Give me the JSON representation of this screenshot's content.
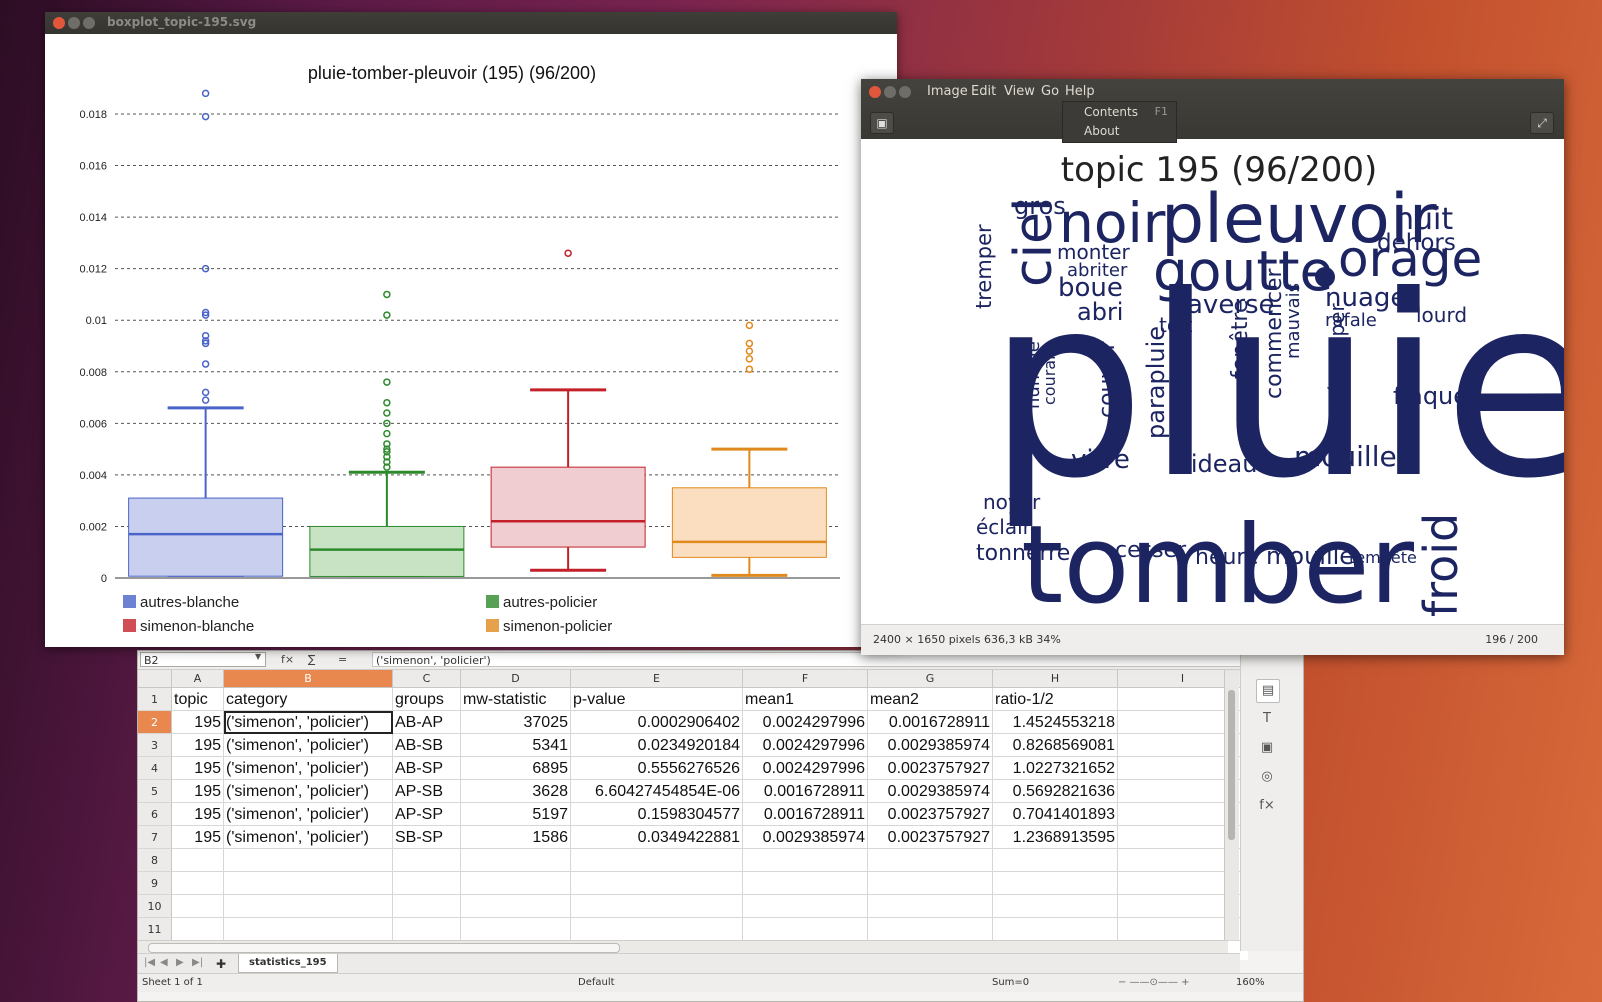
{
  "chart_window": {
    "title": "boxplot_topic-195.svg"
  },
  "chart_data": {
    "type": "boxplot",
    "title": "pluie-tomber-pleuvoir (195) (96/200)",
    "ylim": [
      0,
      0.019
    ],
    "y_ticks": [
      "0",
      "0.002",
      "0.004",
      "0.006",
      "0.008",
      "0.01",
      "0.012",
      "0.014",
      "0.016",
      "0.018"
    ],
    "grid": "horizontal-dashed",
    "legend_position": "bottom",
    "series": [
      {
        "name": "autres-blanche",
        "color": "#4a63c8",
        "fill": "#c9d0ef",
        "whisker_low": 0.0001,
        "q1": 7e-05,
        "median": 0.0017,
        "q3": 0.0031,
        "whisker_high": 0.0066,
        "outliers": [
          0.0069,
          0.0072,
          0.0083,
          0.0091,
          0.0092,
          0.0094,
          0.0102,
          0.0103,
          0.012,
          0.0179,
          0.0188
        ]
      },
      {
        "name": "autres-policier",
        "color": "#2c8a2c",
        "fill": "#c7e3c3",
        "whisker_low": 0.0001,
        "q1": 6e-05,
        "median": 0.0011,
        "q3": 0.002,
        "whisker_high": 0.0041,
        "outliers": [
          0.0043,
          0.0045,
          0.0047,
          0.0049,
          0.005,
          0.0052,
          0.0056,
          0.006,
          0.0064,
          0.0068,
          0.0076,
          0.0102,
          0.011
        ]
      },
      {
        "name": "simenon-blanche",
        "color": "#c4202a",
        "fill": "#efcdd0",
        "whisker_low": 0.0003,
        "q1": 0.0012,
        "median": 0.0022,
        "q3": 0.0043,
        "whisker_high": 0.0073,
        "outliers": [
          0.0126
        ]
      },
      {
        "name": "simenon-policier",
        "color": "#e08a1e",
        "fill": "#fbdec0",
        "whisker_low": 0.0001,
        "q1": 0.0008,
        "median": 0.0014,
        "q3": 0.0035,
        "whisker_high": 0.005,
        "outliers": [
          0.0081,
          0.0085,
          0.0088,
          0.0091,
          0.0098
        ]
      }
    ]
  },
  "viewer": {
    "menu": [
      "Image",
      "Edit",
      "View",
      "Go",
      "Help"
    ],
    "help_menu": {
      "contents": "Contents",
      "contents_shortcut": "F1",
      "about": "About"
    },
    "status_left": "2400 × 1650 pixels  636,3 kB   34%",
    "status_right": "196 / 200",
    "cloud_color": "#1c2461",
    "cloud_title": "topic 195 (96/200)",
    "words": [
      "pluie",
      "tomber",
      "pleuvoir",
      "goutte",
      "orage",
      "noir",
      "ciel",
      "froid",
      "nuit",
      "dehors",
      "nuage",
      "averse",
      "gros",
      "monter",
      "abriter",
      "boue",
      "abri",
      "toit",
      "rafale",
      "lourd",
      "tremper",
      "fenêtre",
      "commencer",
      "mauvais",
      "détremper",
      "parapluie",
      "couvrir",
      "humide",
      "courant",
      "flaque",
      "vitre",
      "rideau",
      "mouiller",
      "noyer",
      "éclair",
      "tonnerre",
      "cesser",
      "heure",
      "mouillé",
      "tempête"
    ]
  },
  "spreadsheet": {
    "name_box": "B2",
    "formula": "('simenon', 'policier')",
    "columns": [
      "A",
      "B",
      "C",
      "D",
      "E",
      "F",
      "G",
      "H",
      "I"
    ],
    "rows": [
      [
        "topic",
        "category",
        "groups",
        "mw-statistic",
        "p-value",
        "mean1",
        "mean2",
        "ratio-1/2"
      ],
      [
        "195",
        "('simenon', 'policier')",
        "AB-AP",
        "37025",
        "0.0002906402",
        "0.0024297996",
        "0.0016728911",
        "1.4524553218"
      ],
      [
        "195",
        "('simenon', 'policier')",
        "AB-SB",
        "5341",
        "0.0234920184",
        "0.0024297996",
        "0.0029385974",
        "0.8268569081"
      ],
      [
        "195",
        "('simenon', 'policier')",
        "AB-SP",
        "6895",
        "0.5556276526",
        "0.0024297996",
        "0.0023757927",
        "1.0227321652"
      ],
      [
        "195",
        "('simenon', 'policier')",
        "AP-SB",
        "3628",
        "6.60427454854E-06",
        "0.0016728911",
        "0.0029385974",
        "0.5692821636"
      ],
      [
        "195",
        "('simenon', 'policier')",
        "AP-SP",
        "5197",
        "0.1598304577",
        "0.0016728911",
        "0.0023757927",
        "0.7041401893"
      ],
      [
        "195",
        "('simenon', 'policier')",
        "SB-SP",
        "1586",
        "0.0349422881",
        "0.0029385974",
        "0.0023757927",
        "1.2368913595"
      ]
    ],
    "row_numbers": [
      "1",
      "2",
      "3",
      "4",
      "5",
      "6",
      "7",
      "8",
      "9",
      "10",
      "11"
    ],
    "sheet_tab": "statistics_195",
    "status": {
      "sheet": "Sheet 1 of 1",
      "style": "Default",
      "sum": "Sum=0",
      "zoom": "160%"
    }
  }
}
